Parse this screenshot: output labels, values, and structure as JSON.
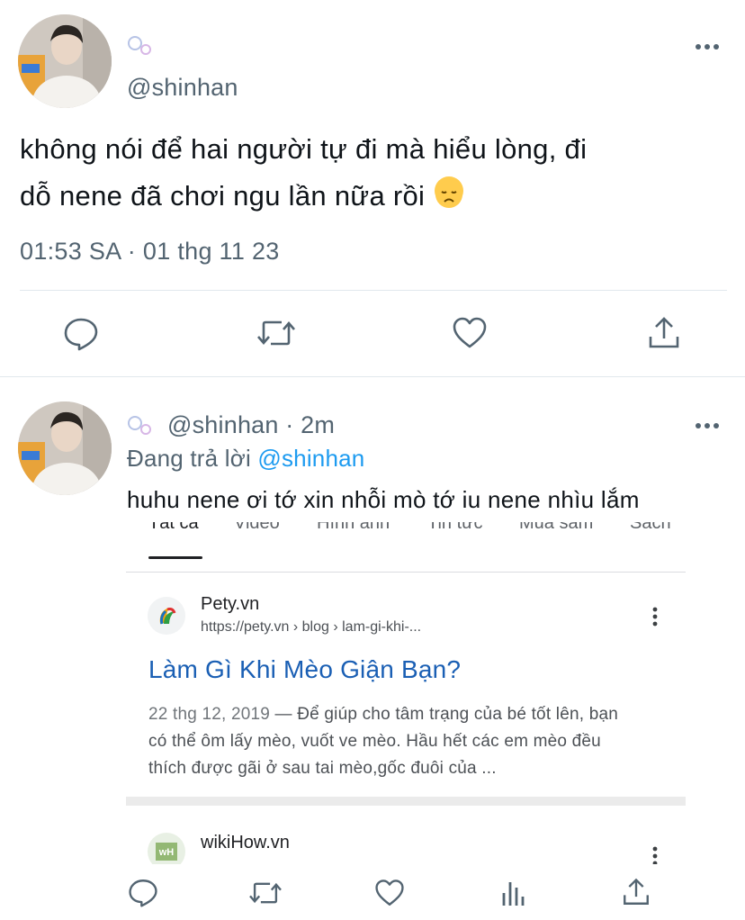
{
  "tweet": {
    "handle": "@shinhan",
    "text_line1": "không nói để hai người tự đi mà hiểu lòng, đi",
    "text_line2": "dỗ nene đã chơi ngu lần nữa rồi",
    "emoji": "disappointed-face",
    "timestamp": "01:53 SA · 01 thg 11 23",
    "actions": [
      "reply",
      "retweet",
      "like",
      "share"
    ]
  },
  "reply": {
    "handle_time": "@shinhan · 2m",
    "replying_prefix": "Đang trả lời ",
    "replying_to": "@shinhan",
    "text": "huhu nene ơi tớ xin nhỗi mò tớ iu nene nhìu lắm",
    "actions": [
      "reply",
      "retweet",
      "like",
      "analytics",
      "share"
    ]
  },
  "embed": {
    "tabs": [
      "Tất cả",
      "Video",
      "Hình ảnh",
      "Tin tức",
      "Mua sắm",
      "Sách"
    ],
    "active_tab": "Tất cả",
    "result1": {
      "site_name": "Pety.vn",
      "url": "https://pety.vn › blog › lam-gi-khi-...",
      "title": "Làm Gì Khi Mèo Giận Bạn?",
      "date": "22 thg 12, 2019",
      "snippet_line1": " — Để giúp cho tâm trạng của bé tốt lên, bạn",
      "snippet_line2": "có thể ôm lấy mèo, vuốt ve mèo. Hầu hết các em mèo đều",
      "snippet_line3": "thích được gãi ở sau tai mèo,gốc đuôi của ..."
    },
    "result2": {
      "site_name": "wikiHow.vn",
      "logo_text": "wH"
    }
  },
  "colors": {
    "text": "#0f1419",
    "secondary": "#536471",
    "link": "#1d9bf0",
    "result_title": "#1a5fb4"
  }
}
